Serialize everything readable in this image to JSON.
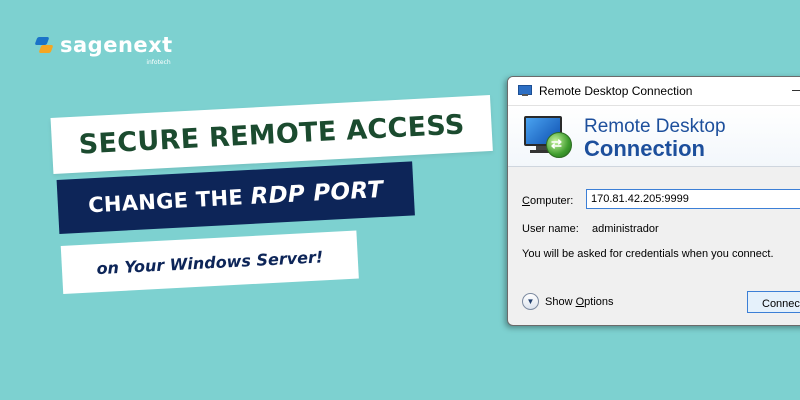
{
  "logo": {
    "text": "sagenext",
    "subtext": "infotech"
  },
  "banners": {
    "line1": "SECURE REMOTE ACCESS",
    "line2_prefix": "CHANGE THE ",
    "line2_emphasis": "RDP PORT",
    "line3": "on Your Windows Server!"
  },
  "rdp_window": {
    "title": "Remote Desktop Connection",
    "header_line1": "Remote Desktop",
    "header_line2": "Connection",
    "computer_label_underlined": "C",
    "computer_label_rest": "omputer:",
    "computer_value": "170.81.42.205:9999",
    "username_label": "User name:",
    "username_value": "administrador",
    "info_text": "You will be asked for credentials when you connect.",
    "show_options_prefix": "Show ",
    "show_options_underlined": "O",
    "show_options_rest": "ptions",
    "connect_label": "Connect"
  },
  "colors": {
    "background": "#7dd1d0",
    "banner_green_text": "#1b4b2f",
    "banner_navy": "#0d2558",
    "rdp_header_blue": "#1d4f9c"
  }
}
